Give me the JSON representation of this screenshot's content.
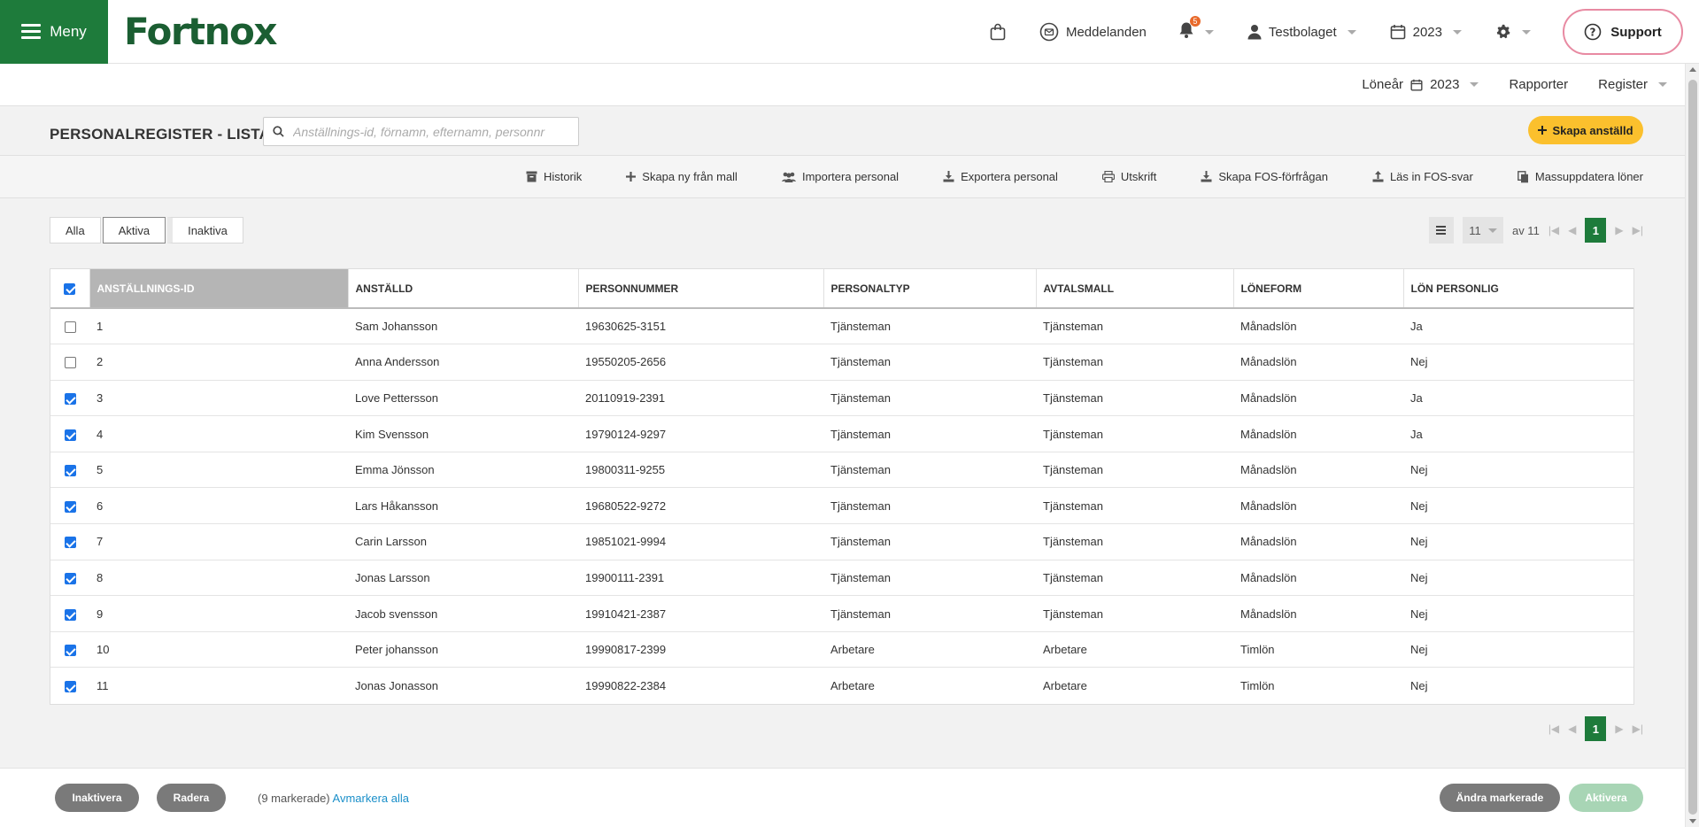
{
  "header": {
    "menu_label": "Meny",
    "logo_text": "Fortnox",
    "messages_label": "Meddelanden",
    "notification_count": "5",
    "company_label": "Testbolaget",
    "year_label": "2023",
    "support_label": "Support",
    "brand_color": "#1e7b3b"
  },
  "subnav": {
    "loneår_label": "Löneår",
    "year_value": "2023",
    "rapporter_label": "Rapporter",
    "register_label": "Register"
  },
  "page": {
    "title": "PERSONALREGISTER - LISTA",
    "search_placeholder": "Anställnings-id, förnamn, efternamn, personnr",
    "create_label": "Skapa anställd"
  },
  "actions": {
    "historik": "Historik",
    "skapa_mall": "Skapa ny från mall",
    "importera": "Importera personal",
    "exportera": "Exportera personal",
    "utskrift": "Utskrift",
    "fos_request": "Skapa FOS-förfrågan",
    "fos_read": "Läs in FOS-svar",
    "mass_update": "Massuppdatera löner"
  },
  "filters": {
    "alla": "Alla",
    "aktiva": "Aktiva",
    "inaktiva": "Inaktiva"
  },
  "pager": {
    "page_size": "11",
    "of_label": "av 11",
    "current_page": "1"
  },
  "table": {
    "columns": [
      "ANSTÄLLNINGS-ID",
      "ANSTÄLLD",
      "PERSONNUMMER",
      "PERSONALTYP",
      "AVTALSMALL",
      "LÖNEFORM",
      "LÖN PERSONLIG"
    ],
    "rows": [
      {
        "checked": false,
        "id": "1",
        "name": "Sam Johansson",
        "pnr": "19630625-3151",
        "typ": "Tjänsteman",
        "avtal": "Tjänsteman",
        "form": "Månadslön",
        "personlig": "Ja"
      },
      {
        "checked": false,
        "id": "2",
        "name": "Anna Andersson",
        "pnr": "19550205-2656",
        "typ": "Tjänsteman",
        "avtal": "Tjänsteman",
        "form": "Månadslön",
        "personlig": "Nej"
      },
      {
        "checked": true,
        "id": "3",
        "name": "Love Pettersson",
        "pnr": "20110919-2391",
        "typ": "Tjänsteman",
        "avtal": "Tjänsteman",
        "form": "Månadslön",
        "personlig": "Ja"
      },
      {
        "checked": true,
        "id": "4",
        "name": "Kim Svensson",
        "pnr": "19790124-9297",
        "typ": "Tjänsteman",
        "avtal": "Tjänsteman",
        "form": "Månadslön",
        "personlig": "Ja"
      },
      {
        "checked": true,
        "id": "5",
        "name": "Emma Jönsson",
        "pnr": "19800311-9255",
        "typ": "Tjänsteman",
        "avtal": "Tjänsteman",
        "form": "Månadslön",
        "personlig": "Nej"
      },
      {
        "checked": true,
        "id": "6",
        "name": "Lars Håkansson",
        "pnr": "19680522-9272",
        "typ": "Tjänsteman",
        "avtal": "Tjänsteman",
        "form": "Månadslön",
        "personlig": "Nej"
      },
      {
        "checked": true,
        "id": "7",
        "name": "Carin Larsson",
        "pnr": "19851021-9994",
        "typ": "Tjänsteman",
        "avtal": "Tjänsteman",
        "form": "Månadslön",
        "personlig": "Nej"
      },
      {
        "checked": true,
        "id": "8",
        "name": "Jonas Larsson",
        "pnr": "19900111-2391",
        "typ": "Tjänsteman",
        "avtal": "Tjänsteman",
        "form": "Månadslön",
        "personlig": "Nej"
      },
      {
        "checked": true,
        "id": "9",
        "name": "Jacob svensson",
        "pnr": "19910421-2387",
        "typ": "Tjänsteman",
        "avtal": "Tjänsteman",
        "form": "Månadslön",
        "personlig": "Nej"
      },
      {
        "checked": true,
        "id": "10",
        "name": "Peter johansson",
        "pnr": "19990817-2399",
        "typ": "Arbetare",
        "avtal": "Arbetare",
        "form": "Timlön",
        "personlig": "Nej"
      },
      {
        "checked": true,
        "id": "11",
        "name": "Jonas Jonasson",
        "pnr": "19990822-2384",
        "typ": "Arbetare",
        "avtal": "Arbetare",
        "form": "Timlön",
        "personlig": "Nej"
      }
    ]
  },
  "bottom": {
    "inaktivera": "Inaktivera",
    "radera": "Radera",
    "selected_info": "(9 markerade)",
    "deselect_all": "Avmarkera alla",
    "andra_markerade": "Ändra markerade",
    "aktivera": "Aktivera"
  }
}
